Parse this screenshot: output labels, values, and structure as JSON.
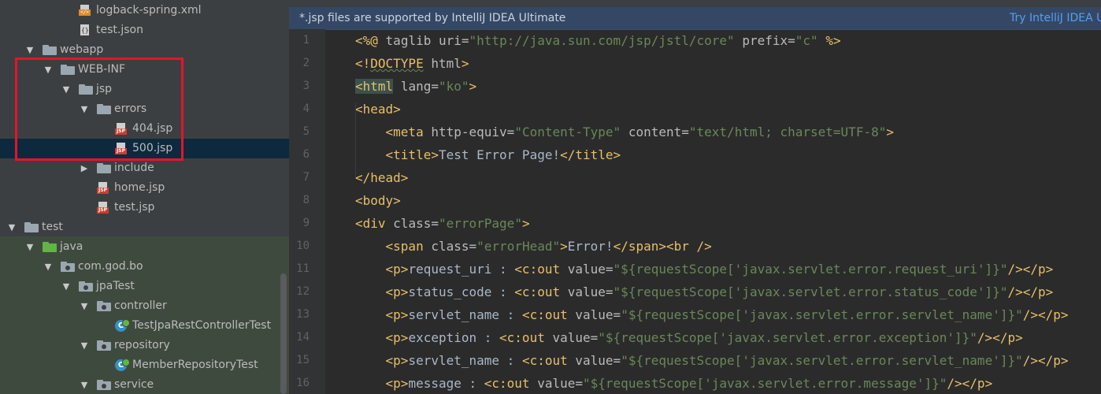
{
  "tree": [
    {
      "label": "logback-spring.xml",
      "icon": "xml-file-icon",
      "depth": 3,
      "arrow": ""
    },
    {
      "label": "test.json",
      "icon": "json-file-icon",
      "depth": 3,
      "arrow": ""
    },
    {
      "label": "webapp",
      "icon": "folder-icon",
      "depth": 1,
      "arrow": "down"
    },
    {
      "label": "WEB-INF",
      "icon": "folder-icon",
      "depth": 2,
      "arrow": "down"
    },
    {
      "label": "jsp",
      "icon": "folder-icon",
      "depth": 3,
      "arrow": "down"
    },
    {
      "label": "errors",
      "icon": "folder-icon",
      "depth": 4,
      "arrow": "down"
    },
    {
      "label": "404.jsp",
      "icon": "jsp-file-icon",
      "depth": 5,
      "arrow": ""
    },
    {
      "label": "500.jsp",
      "icon": "jsp-file-icon",
      "depth": 5,
      "arrow": "",
      "selected": true
    },
    {
      "label": "include",
      "icon": "folder-icon",
      "depth": 4,
      "arrow": "right"
    },
    {
      "label": "home.jsp",
      "icon": "jsp-file-icon",
      "depth": 4,
      "arrow": ""
    },
    {
      "label": "test.jsp",
      "icon": "jsp-file-icon",
      "depth": 4,
      "arrow": ""
    },
    {
      "label": "test",
      "icon": "folder-icon",
      "depth": 0,
      "arrow": "down"
    },
    {
      "label": "java",
      "icon": "green-folder-icon",
      "depth": 1,
      "arrow": "down"
    },
    {
      "label": "com.god.bo",
      "icon": "package-icon",
      "depth": 2,
      "arrow": "down"
    },
    {
      "label": "jpaTest",
      "icon": "package-icon",
      "depth": 3,
      "arrow": "down"
    },
    {
      "label": "controller",
      "icon": "package-icon",
      "depth": 4,
      "arrow": "down"
    },
    {
      "label": "TestJpaRestControllerTest",
      "icon": "class-icon",
      "depth": 5,
      "arrow": ""
    },
    {
      "label": "repository",
      "icon": "package-icon",
      "depth": 4,
      "arrow": "down"
    },
    {
      "label": "MemberRepositoryTest",
      "icon": "class-icon",
      "depth": 5,
      "arrow": ""
    },
    {
      "label": "service",
      "icon": "package-icon",
      "depth": 4,
      "arrow": "down"
    }
  ],
  "banner": {
    "message": "*.jsp files are supported by IntelliJ IDEA Ultimate",
    "link": "Try IntelliJ IDEA Ultimate"
  },
  "code": [
    "<%@ taglib uri=\"http://java.sun.com/jsp/jstl/core\" prefix=\"c\" %>",
    "<!DOCTYPE html>",
    "<html lang=\"ko\">",
    "<head>",
    "    <meta http-equiv=\"Content-Type\" content=\"text/html; charset=UTF-8\">",
    "    <title>Test Error Page!</title>",
    "</head>",
    "<body>",
    "<div class=\"errorPage\">",
    "    <span class=\"errorHead\">Error!</span><br />",
    "    <p>request_uri : <c:out value=\"${requestScope['javax.servlet.error.request_uri']}\"/></p>",
    "    <p>status_code : <c:out value=\"${requestScope['javax.servlet.error.status_code']}\"/></p>",
    "    <p>servlet_name : <c:out value=\"${requestScope['javax.servlet.error.servlet_name']}\"/></p>",
    "    <p>exception : <c:out value=\"${requestScope['javax.servlet.error.exception']}\"/></p>",
    "    <p>servlet_name : <c:out value=\"${requestScope['javax.servlet.error.servlet_name']}\"/></p>",
    "    <p>message : <c:out value=\"${requestScope['javax.servlet.error.message']}\"/></p>"
  ],
  "line_numbers": [
    "1",
    "2",
    "3",
    "4",
    "5",
    "6",
    "7",
    "8",
    "9",
    "10",
    "11",
    "12",
    "13",
    "14",
    "15",
    "16"
  ],
  "colors": {
    "tag": "#e8bf6a",
    "attribute": "#bababa",
    "string": "#6a8759",
    "text": "#a9b7c6",
    "selection": "#0d293e",
    "highlight_box": "#e2152b"
  }
}
